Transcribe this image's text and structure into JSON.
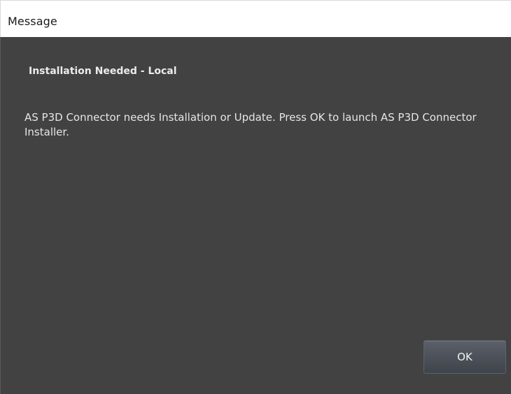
{
  "window": {
    "title": "Message"
  },
  "message": {
    "heading": "Installation Needed - Local",
    "body": "AS P3D Connector needs Installation or Update.  Press OK to launch AS P3D Connector Installer."
  },
  "actions": {
    "ok_label": "OK"
  },
  "colors": {
    "titlebar_bg": "#ffffff",
    "content_bg": "#424242",
    "text": "#e6e6e6",
    "button_bg": "#4c5058"
  }
}
